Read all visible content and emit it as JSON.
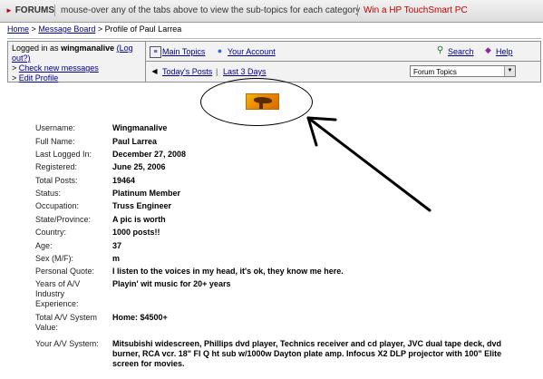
{
  "topbar": {
    "forums_label": "FORUMS",
    "hint": "mouse-over any of the tabs above to view the sub-topics for each category",
    "promo": "Win a HP TouchSmart PC"
  },
  "breadcrumb": {
    "home": "Home",
    "sep1": ">",
    "board": "Message Board",
    "sep2": ">",
    "current": "Profile of Paul Larrea"
  },
  "userbox": {
    "logged_in_prefix": "Logged in as",
    "username": "wingmanalive",
    "logout_label": "(Log out?)",
    "check_messages": "Check new messages",
    "edit_profile": "Edit Profile",
    "main_topics": "Main Topics",
    "your_account": "Your Account",
    "search": "Search",
    "help": "Help",
    "todays_posts": "Today's Posts",
    "divider": "|",
    "last_3_days": "Last 3 Days",
    "forum_select": "Forum Topics"
  },
  "profile": [
    {
      "label": "Username:",
      "value": "Wingmanalive"
    },
    {
      "label": "Full Name:",
      "value": "Paul Larrea"
    },
    {
      "label": "Last Logged In:",
      "value": "December 27, 2008"
    },
    {
      "label": "Registered:",
      "value": "June 25, 2006"
    },
    {
      "label": "Total Posts:",
      "value": "19464"
    },
    {
      "label": "Status:",
      "value": "Platinum Member"
    },
    {
      "label": "Occupation:",
      "value": "Truss Engineer"
    },
    {
      "label": "State/Province:",
      "value": "A pic is worth"
    },
    {
      "label": "Country:",
      "value": "1000 posts!!"
    },
    {
      "label": "Age:",
      "value": "37"
    },
    {
      "label": "Sex (M/F):",
      "value": "m"
    },
    {
      "label": "Personal Quote:",
      "value": "I listen to the voices in my head, it's ok, they know me here."
    },
    {
      "label": "Years of A/V Industry Experience:",
      "value": "Playin' wit music for 20+ years"
    },
    {
      "label": "Total A/V System Value:",
      "value": "Home: $4500+"
    },
    {
      "label": "Your A/V System:",
      "value": "Mitsubishi widescreen, Phillips dvd player, Technics receiver and cd player, JVC dual tape deck, dvd burner, RCA vcr. 18\" Fl Q ht sub w/1000w Dayton plate amp. Infocus X2 DLP projector with 100\" Elite screen for movies."
    }
  ],
  "colors": {
    "link": "#00008b",
    "promo": "#c00000",
    "panel": "#f2f2f2"
  },
  "icons": [
    "main-topics-icon",
    "account-icon",
    "search-icon",
    "help-icon",
    "todays-posts-icon",
    "dropdown-arrow-icon"
  ]
}
